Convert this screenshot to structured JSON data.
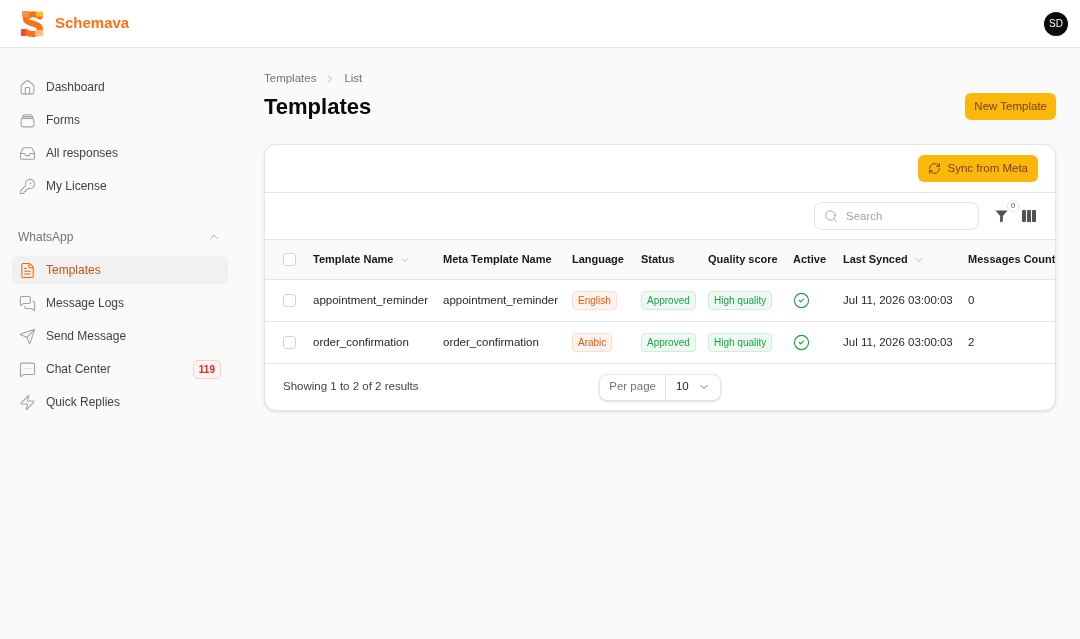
{
  "header": {
    "brand": "Schemava",
    "user_initials": "SD"
  },
  "sidebar": {
    "items": [
      {
        "label": "Dashboard",
        "selected": false
      },
      {
        "label": "Forms",
        "selected": false
      },
      {
        "label": "All responses",
        "selected": false
      },
      {
        "label": "My License",
        "selected": false
      }
    ],
    "sections": [
      {
        "title": "WhatsApp",
        "expanded": true,
        "items": [
          {
            "label": "Templates",
            "selected": true
          },
          {
            "label": "Message Logs",
            "selected": false
          },
          {
            "label": "Send Message",
            "selected": false
          },
          {
            "label": "Chat Center",
            "selected": false,
            "badge": "119"
          },
          {
            "label": "Quick Replies",
            "selected": false
          }
        ]
      }
    ]
  },
  "breadcrumb": [
    "Templates",
    "List"
  ],
  "page_title": "Templates",
  "new_button": "New Template",
  "panel": {
    "sync_button": "Sync from Meta",
    "search": {
      "placeholder": "Search"
    },
    "filter_count": "0",
    "table": {
      "select_all_checked": false,
      "columns": [
        {
          "label": "Template Name",
          "kind": "text",
          "sortable": true
        },
        {
          "label": "Meta Template Name",
          "kind": "text",
          "sortable": false
        },
        {
          "label": "Language",
          "kind": "tag",
          "color": "#ea580c",
          "sortable": false
        },
        {
          "label": "Status",
          "kind": "tag",
          "color": "#16a34a",
          "sortable": false
        },
        {
          "label": "Quality score",
          "kind": "tag",
          "color": "#16a34a",
          "sortable": false
        },
        {
          "label": "Active",
          "kind": "check",
          "sortable": false
        },
        {
          "label": "Last Synced",
          "kind": "text",
          "sortable": true
        },
        {
          "label": "Messages Count",
          "kind": "text",
          "sortable": false
        }
      ],
      "rows": [
        {
          "checked": false,
          "cells": [
            "appointment_reminder",
            "appointment_reminder",
            "English",
            "Approved",
            "High quality",
            true,
            "Jul 11, 2026 03:00:03",
            "0"
          ]
        },
        {
          "checked": false,
          "cells": [
            "order_confirmation",
            "order_confirmation",
            "Arabic",
            "Approved",
            "High quality",
            true,
            "Jul 11, 2026 03:00:03",
            "2"
          ]
        }
      ]
    },
    "footer": {
      "summary": "Showing 1 to 2 of 2 results",
      "per_page_label": "Per page",
      "per_page": "10"
    }
  }
}
